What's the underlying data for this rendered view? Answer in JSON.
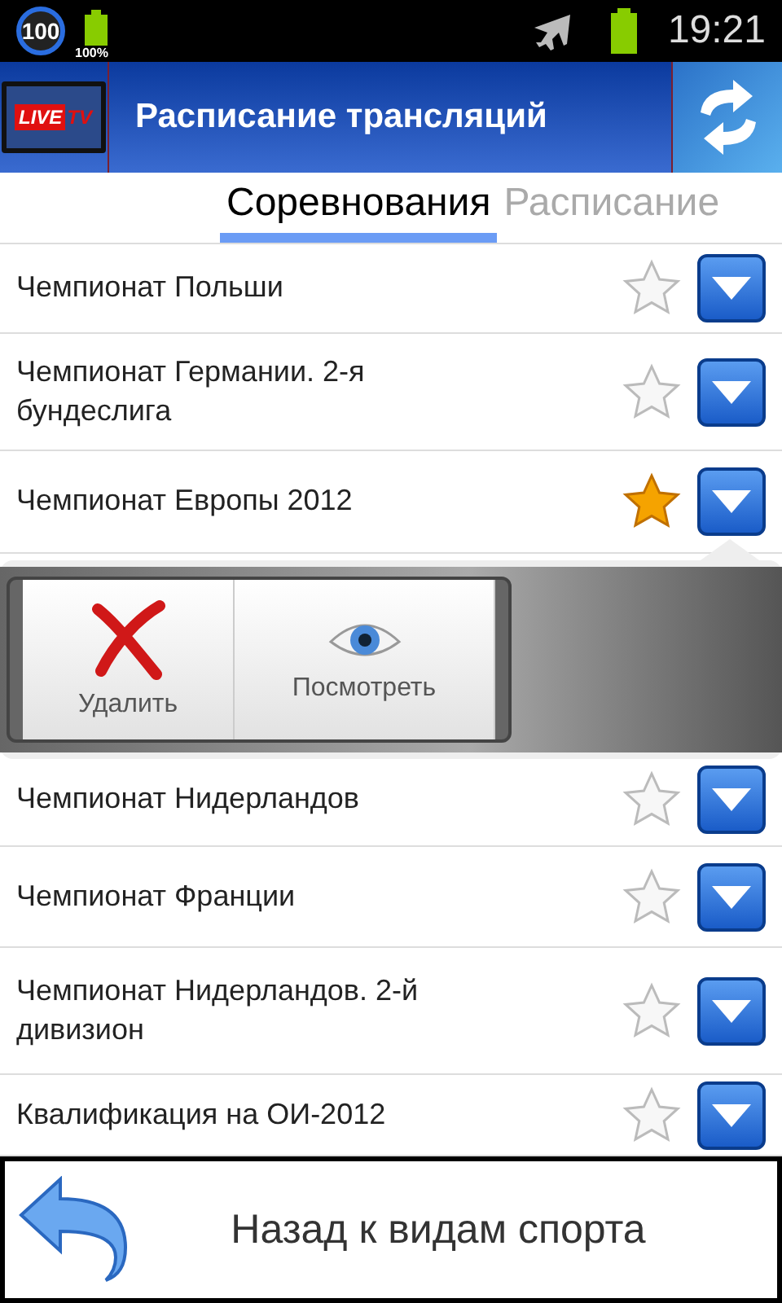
{
  "status_bar": {
    "badge": "100",
    "battery_label": "100%",
    "time": "19:21"
  },
  "header": {
    "logo": {
      "word_1": "LIVE",
      "word_2": "TV"
    },
    "title": "Расписание трансляций"
  },
  "tabs": [
    {
      "label": "Соревнования",
      "selected": true
    },
    {
      "label": "Расписание",
      "selected": false
    }
  ],
  "competitions": [
    {
      "name": "Чемпионат Польши",
      "favorite": false
    },
    {
      "name": "Чемпионат Германии. 2-я бундеслига",
      "favorite": false
    },
    {
      "name": "Чемпионат Европы 2012",
      "favorite": true
    },
    {
      "name": "Чемпионат Нидерландов",
      "favorite": false
    },
    {
      "name": "Чемпионат Франции",
      "favorite": false
    },
    {
      "name": "Чемпионат Нидерландов. 2-й дивизион",
      "favorite": false
    },
    {
      "name": "Квалификация на ОИ-2012",
      "favorite": false
    }
  ],
  "popup": {
    "actions": [
      {
        "kind": "delete",
        "label": "Удалить"
      },
      {
        "kind": "view",
        "label": "Посмотреть"
      }
    ]
  },
  "back_button": {
    "label": "Назад к видам спорта"
  }
}
